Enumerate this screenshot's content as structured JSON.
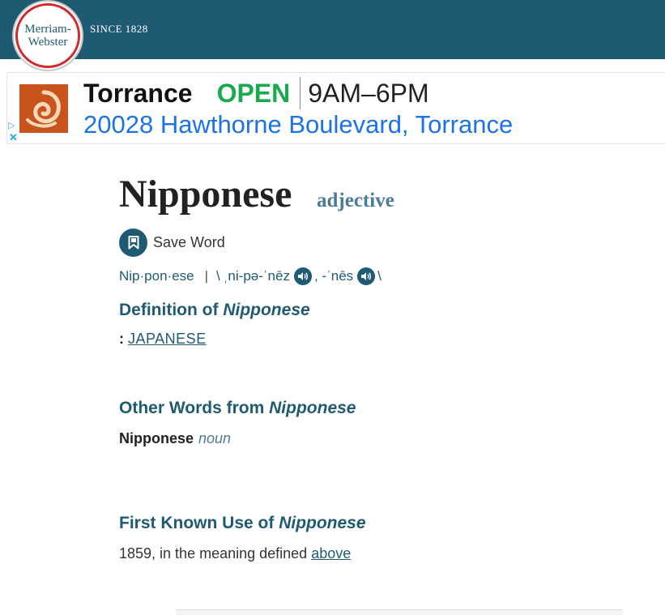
{
  "header": {
    "logo_line1": "Merriam-",
    "logo_line2": "Webster",
    "since": "SINCE 1828",
    "bg_color": "#1f5a73"
  },
  "ad": {
    "business_name": "Torrance",
    "status": "OPEN",
    "hours": "9AM–6PM",
    "address": "20028 Hawthorne Boulevard, Torrance",
    "adchoices_icon": "play-triangle-icon",
    "close_icon": "close-icon"
  },
  "entry": {
    "word": "Nipponese",
    "part_of_speech": "adjective",
    "save_label": "Save Word",
    "syllables": "Nip·pon·ese",
    "pron_sep": "|",
    "pron_open": "\\",
    "pron1": "ˌni-pə-ˈnēz",
    "pron2_prefix": ", -ˈnēs",
    "pron_close": "\\"
  },
  "definition": {
    "heading_prefix": "Definition of",
    "heading_word": "Nipponese",
    "colon": ":",
    "link": "JAPANESE"
  },
  "other_words": {
    "heading_prefix": "Other Words from",
    "heading_word": "Nipponese",
    "word": "Nipponese",
    "pos": "noun"
  },
  "first_known_use": {
    "heading_prefix": "First Known Use of",
    "heading_word": "Nipponese",
    "text": "1859, in the meaning defined",
    "link": "above"
  }
}
